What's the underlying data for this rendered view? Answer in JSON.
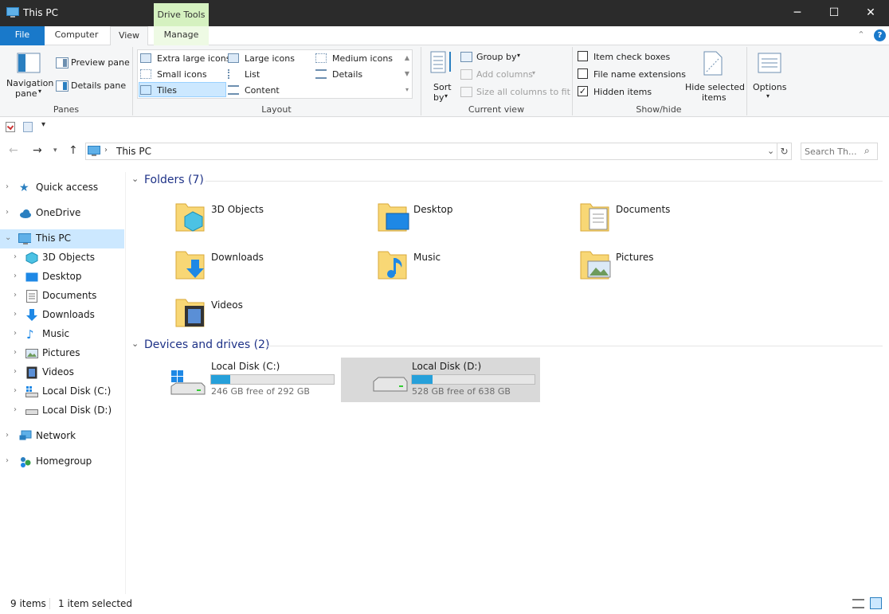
{
  "window": {
    "title": "This PC",
    "context_tab": "Drive Tools",
    "minimize": "─",
    "maximize": "☐",
    "close": "✕"
  },
  "tabs": {
    "file": "File",
    "computer": "Computer",
    "view": "View",
    "manage": "Manage",
    "collapse": "⌃",
    "help": "?"
  },
  "ribbon": {
    "panes": {
      "navigation_pane": "Navigation pane",
      "nav_line1": "Navigation",
      "nav_line2": "pane",
      "preview_pane": "Preview pane",
      "details_pane": "Details pane",
      "label": "Panes"
    },
    "layout": {
      "extra_large": "Extra large icons",
      "large": "Large icons",
      "medium": "Medium icons",
      "small": "Small icons",
      "list": "List",
      "details": "Details",
      "tiles": "Tiles",
      "content": "Content",
      "label": "Layout"
    },
    "current_view": {
      "sort_line1": "Sort",
      "sort_line2": "by",
      "group_by": "Group by",
      "add_columns": "Add columns",
      "size_columns": "Size all columns to fit",
      "label": "Current view"
    },
    "show_hide": {
      "item_check_boxes": "Item check boxes",
      "file_name_extensions": "File name extensions",
      "hidden_items": "Hidden items",
      "hide_line1": "Hide selected",
      "hide_line2": "items",
      "label": "Show/hide"
    },
    "options": {
      "label": "Options"
    }
  },
  "address": {
    "path": "This PC",
    "search_placeholder": "Search Th..."
  },
  "nav": {
    "quick_access": "Quick access",
    "onedrive": "OneDrive",
    "this_pc": "This PC",
    "objects3d": "3D Objects",
    "desktop": "Desktop",
    "documents": "Documents",
    "downloads": "Downloads",
    "music": "Music",
    "pictures": "Pictures",
    "videos": "Videos",
    "disk_c": "Local Disk (C:)",
    "disk_d": "Local Disk (D:)",
    "network": "Network",
    "homegroup": "Homegroup"
  },
  "content": {
    "folders_header": "Folders (7)",
    "folders": [
      "3D Objects",
      "Desktop",
      "Documents",
      "Downloads",
      "Music",
      "Pictures",
      "Videos"
    ],
    "devices_header": "Devices and drives (2)",
    "drives": [
      {
        "name": "Local Disk (C:)",
        "free": "246 GB free of 292 GB",
        "used_fraction": 0.158
      },
      {
        "name": "Local Disk (D:)",
        "free": "528 GB free of 638 GB",
        "used_fraction": 0.172
      }
    ]
  },
  "status": {
    "items": "9 items",
    "selected": "1 item selected"
  },
  "colors": {
    "accent": "#1979ca",
    "selection": "#cce8ff",
    "folder": "#f8d775",
    "bar": "#26a0da",
    "drive_selected": "#d9d9d9"
  }
}
